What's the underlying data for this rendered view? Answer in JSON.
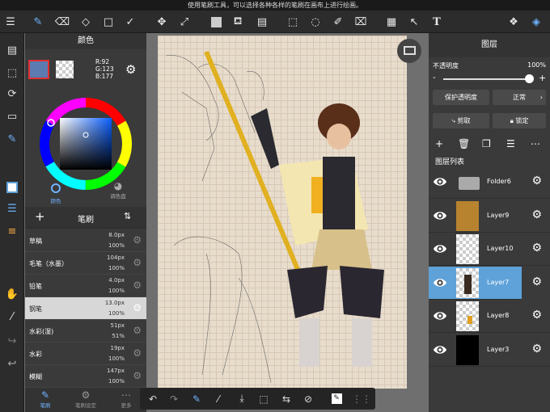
{
  "status": {
    "text": "使用笔刷工具，可以选择各种各样的笔刷在画布上进行绘画。"
  },
  "toolbar": {
    "icons": [
      "menu-icon",
      "brush-icon",
      "eraser-icon",
      "fill-eraser-icon",
      "rectangle-icon",
      "check-icon",
      "move-icon",
      "transform-icon",
      "fill-color-icon",
      "bucket-icon",
      "gradient-icon",
      "select-rect-icon",
      "select-lasso-icon",
      "select-pen-icon",
      "select-eraser-icon",
      "panel-layout-icon",
      "select-cursor-icon",
      "text-icon",
      "materials-icon",
      "layers-icon"
    ]
  },
  "color_panel": {
    "title": "颜色",
    "r": "R:92",
    "g": "G:123",
    "b": "B:177",
    "main_color": "#5c7bb1",
    "tab_color": "颜色",
    "tab_palette": "调色盘"
  },
  "brush_panel": {
    "title": "笔刷",
    "brushes": [
      {
        "name": "草稿",
        "size": "8.0px",
        "opacity": "100%"
      },
      {
        "name": "毛笔（水墨）",
        "size": "104px",
        "opacity": "100%"
      },
      {
        "name": "铅笔",
        "size": "4.0px",
        "opacity": "100%"
      },
      {
        "name": "钢笔",
        "size": "13.0px",
        "opacity": "100%"
      },
      {
        "name": "水彩(湿)",
        "size": "51px",
        "opacity": "51%"
      },
      {
        "name": "水彩",
        "size": "19px",
        "opacity": "100%"
      },
      {
        "name": "模糊",
        "size": "147px",
        "opacity": "100%"
      }
    ],
    "tab_brush": "笔刷",
    "tab_settings": "笔刷设定",
    "tab_more": "更多"
  },
  "layer_panel": {
    "title": "图层",
    "opacity_label": "不透明度",
    "opacity_value": "100%",
    "opacity": 1.0,
    "protect_alpha": "保护透明度",
    "blend_mode": "正常",
    "clip": "剪取",
    "lock": "锁定",
    "list_title": "图层列表",
    "layers": [
      {
        "name": "Folder6"
      },
      {
        "name": "Layer9"
      },
      {
        "name": "Layer10"
      },
      {
        "name": "Layer7"
      },
      {
        "name": "Layer8"
      },
      {
        "name": "Layer3"
      }
    ]
  },
  "accent": "#5ea2d9"
}
